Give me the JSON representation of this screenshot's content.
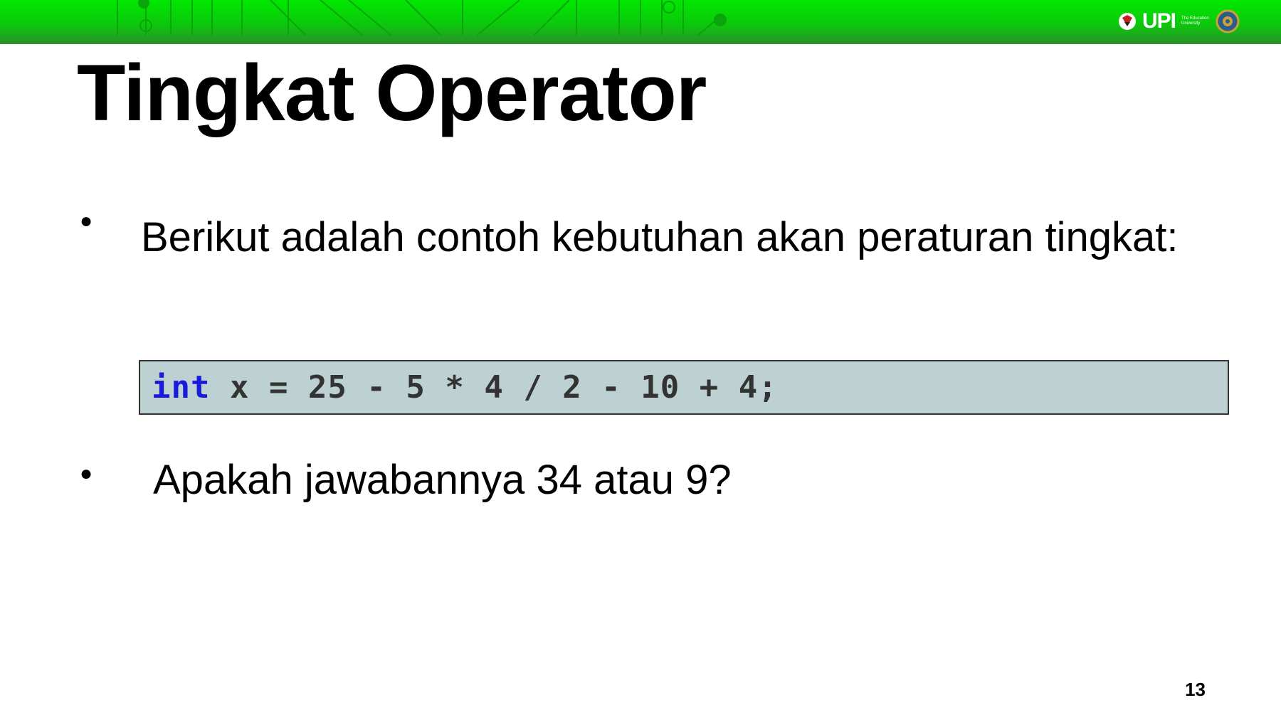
{
  "header": {
    "logo_text": "UPI",
    "logo_tagline": "The Education University"
  },
  "slide": {
    "title": "Tingkat Operator",
    "bullets": [
      "Berikut adalah contoh kebutuhan akan peraturan tingkat:",
      "Apakah jawabannya 34 atau 9?"
    ],
    "code": {
      "keyword": "int",
      "expression": " x = 25 - 5 * 4 / 2 - 10 + 4;"
    },
    "page_number": "13"
  },
  "colors": {
    "header_green": "#0cc80c",
    "code_background": "#bdd1d3",
    "code_keyword": "#1a1adb",
    "code_text": "#333333"
  }
}
